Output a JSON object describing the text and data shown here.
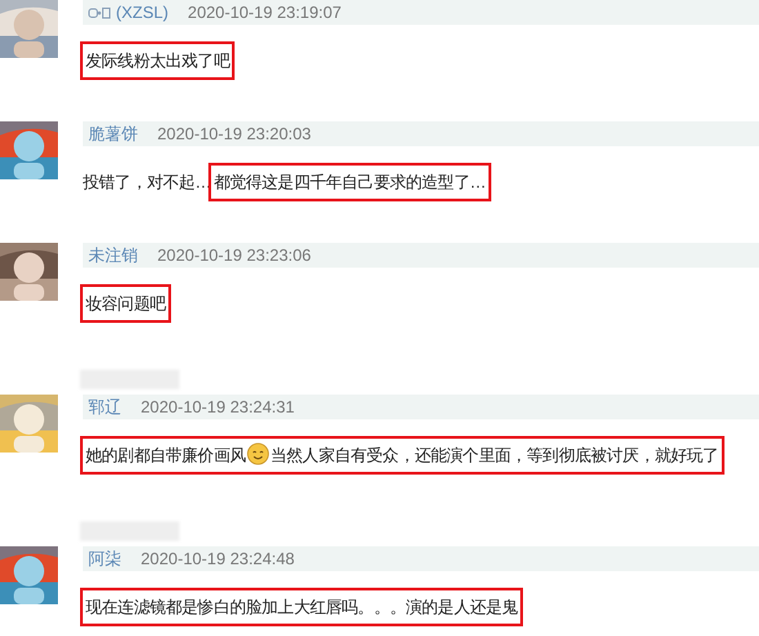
{
  "items": [
    {
      "kind": "comment",
      "icon": true,
      "user": "(XZSL)",
      "time": "2020-10-19 23:19:07",
      "groups": [
        {
          "highlighted": true,
          "parts": [
            {
              "kind": "text",
              "text": "发际线粉太出戏了吧"
            }
          ]
        }
      ]
    },
    {
      "kind": "comment",
      "icon": false,
      "user": "脆薯饼",
      "time": "2020-10-19 23:20:03",
      "groups": [
        {
          "highlighted": false,
          "parts": [
            {
              "kind": "text",
              "text": "投错了，对不起…"
            }
          ]
        },
        {
          "highlighted": true,
          "parts": [
            {
              "kind": "text",
              "text": "都觉得这是四千年自己要求的造型了…"
            }
          ]
        }
      ]
    },
    {
      "kind": "comment",
      "icon": false,
      "user": "未注销",
      "time": "2020-10-19 23:23:06",
      "groups": [
        {
          "highlighted": true,
          "parts": [
            {
              "kind": "text",
              "text": "妆容问题吧"
            }
          ]
        }
      ]
    },
    {
      "kind": "redacted"
    },
    {
      "kind": "comment",
      "icon": false,
      "user": "郓辽",
      "time": "2020-10-19 23:24:31",
      "groups": [
        {
          "highlighted": true,
          "parts": [
            {
              "kind": "text",
              "text": "她的剧都自带廉价画风"
            },
            {
              "kind": "emoji"
            },
            {
              "kind": "text",
              "text": "当然人家自有受众，还能演个里面，等到彻底被讨厌，就好玩了"
            }
          ]
        }
      ]
    },
    {
      "kind": "redacted"
    },
    {
      "kind": "comment",
      "icon": false,
      "user": "阿柒",
      "time": "2020-10-19 23:24:48",
      "groups": [
        {
          "highlighted": true,
          "parts": [
            {
              "kind": "text",
              "text": "现在连滤镜都是惨白的脸加上大红唇吗。。。演的是人还是鬼"
            }
          ]
        }
      ]
    }
  ]
}
